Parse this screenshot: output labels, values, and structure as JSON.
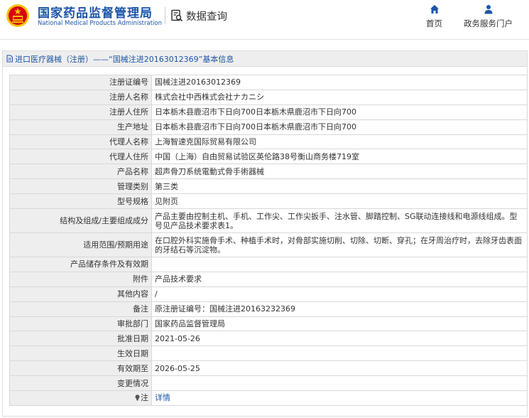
{
  "header": {
    "brand_cn": "国家药品监督管理局",
    "brand_en": "National Medical Products Administration",
    "query_label": "数据查询",
    "nav": [
      {
        "label": "首页",
        "icon": "home-icon"
      },
      {
        "label": "政务服务门户",
        "icon": "user-icon"
      }
    ],
    "colors": {
      "brand": "#1d55a8",
      "emblem_red": "#d7000f",
      "emblem_gold": "#f5c400"
    }
  },
  "breadcrumb": "进口医疗器械（注册）——“国械注进20163012369”基本信息",
  "rows": [
    {
      "key": "注册证编号",
      "value": "国械注进20163012369"
    },
    {
      "key": "注册人名称",
      "value": "株式会社中西株式会社ナカニシ"
    },
    {
      "key": "注册人住所",
      "value": "日本栃木县鹿沼市下日向700日本栃木県鹿沼市下日向700"
    },
    {
      "key": "生产地址",
      "value": "日本栃木县鹿沼市下日向700日本栃木県鹿沼市下日向700"
    },
    {
      "key": "代理人名称",
      "value": "上海智速克国际贸易有限公司"
    },
    {
      "key": "代理人住所",
      "value": "中国（上海）自由贸易试验区英伦路38号衡山商务楼719室"
    },
    {
      "key": "产品名称",
      "value": "超声骨刀系统電動式骨手術器械"
    },
    {
      "key": "管理类别",
      "value": "第三类"
    },
    {
      "key": "型号规格",
      "value": "见附页"
    },
    {
      "key": "结构及组成/主要组成成分",
      "value": "产品主要由控制主机、手机、工作尖、工作尖扳手、注水管、脚踏控制、SG联动连接线和电源线组成。型号见产品技术要求表1。"
    },
    {
      "key": "适用范围/预期用途",
      "value": "在口腔外科实施骨手术、种植手术时，对骨部实施切削、切除、切断、穿孔；在牙周治疗时，去除牙齿表面的牙结石等沉淀物。"
    },
    {
      "key": "产品储存条件及有效期",
      "value": ""
    },
    {
      "key": "附件",
      "value": "产品技术要求"
    },
    {
      "key": "其他内容",
      "value": "/"
    },
    {
      "key": "备注",
      "value": "原注册证编号：国械注进20163232369"
    },
    {
      "key": "审批部门",
      "value": "国家药品监督管理局"
    },
    {
      "key": "批准日期",
      "value": "2021-05-26"
    },
    {
      "key": "生效日期",
      "value": ""
    },
    {
      "key": "有效期至",
      "value": "2026-05-25"
    },
    {
      "key": "变更情况",
      "value": ""
    },
    {
      "key": "注",
      "value": "详情"
    }
  ]
}
